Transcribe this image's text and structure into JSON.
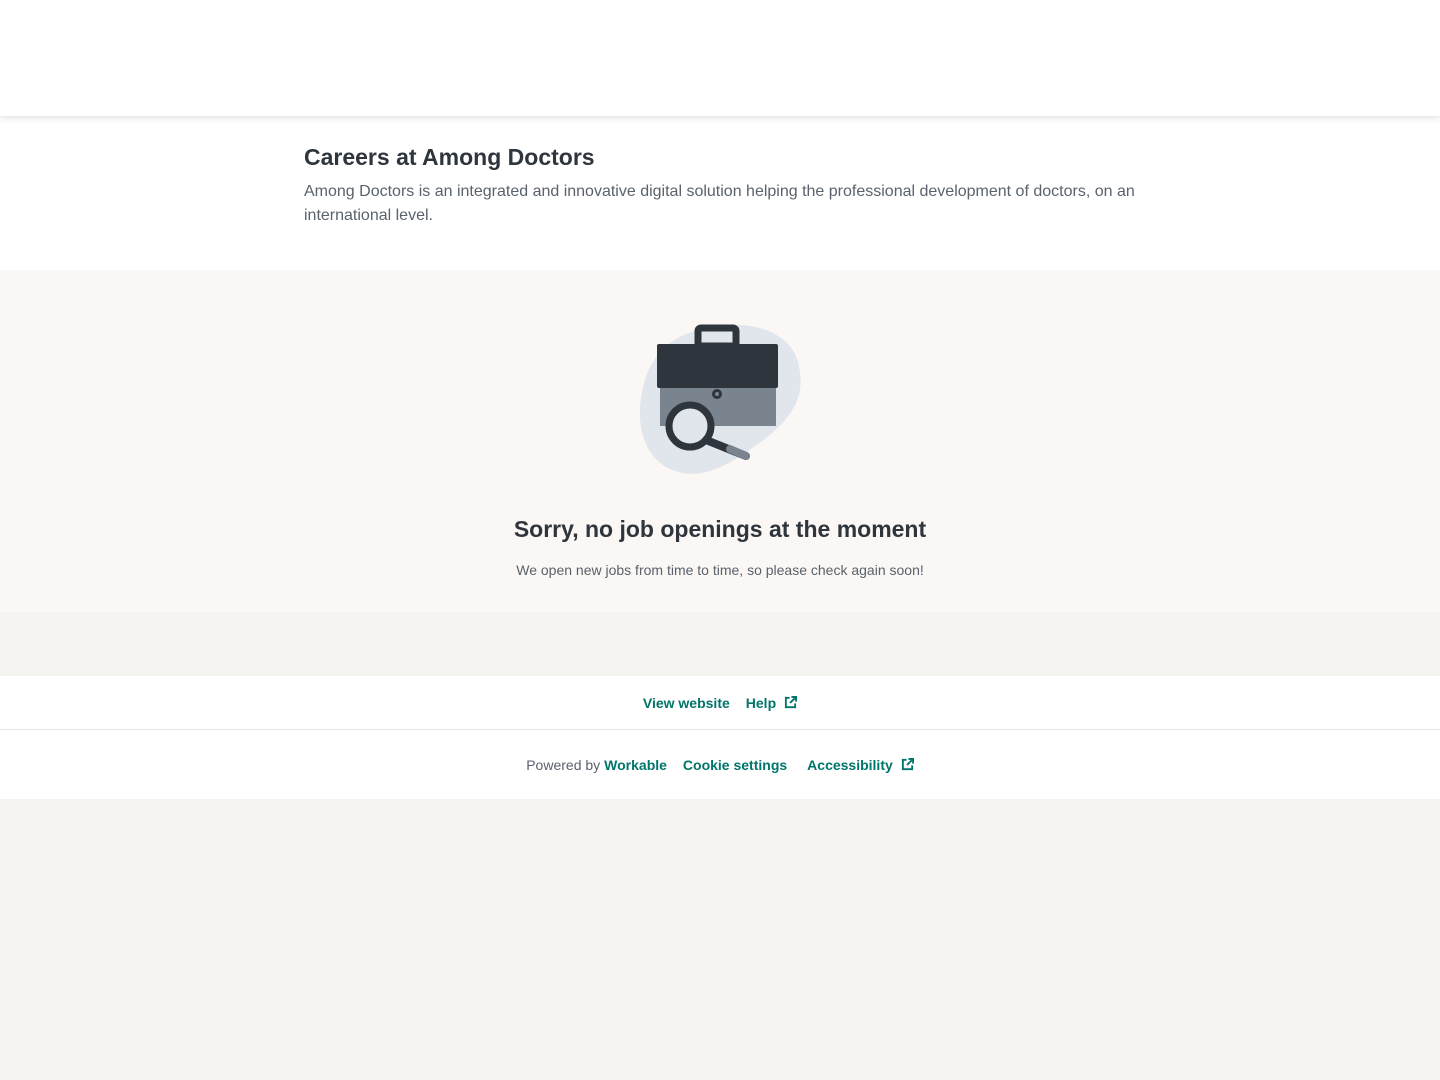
{
  "company": {
    "title": "Careers at Among Doctors",
    "description": "Among Doctors is an integrated and innovative digital solution helping the professional development of doctors, on an international level."
  },
  "empty_state": {
    "illustration_icon": "briefcase-search-icon",
    "title": "Sorry, no job openings at the moment",
    "subtitle": "We open new jobs from time to time, so please check again soon!"
  },
  "footer": {
    "view_website": "View website",
    "help": "Help",
    "powered_by": "Powered by",
    "workable": "Workable",
    "cookie_settings": "Cookie settings",
    "accessibility": "Accessibility"
  },
  "colors": {
    "accent": "#00756a",
    "text_dark": "#2f353d",
    "text_muted": "#5a626c",
    "empty_bg": "#faf7f4",
    "page_bg": "#f5f4f0"
  }
}
